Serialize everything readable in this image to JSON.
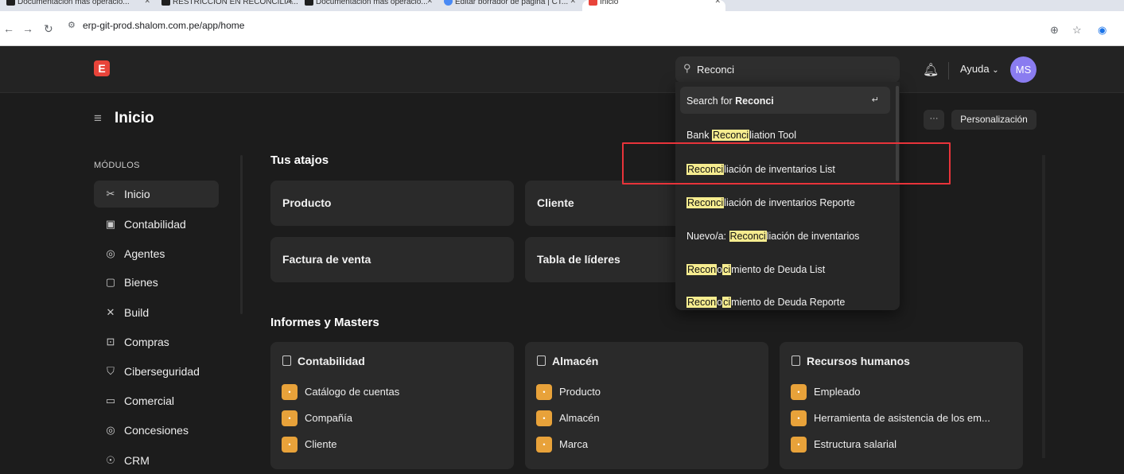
{
  "browser": {
    "tabs": [
      {
        "label": "Documentación más operació..."
      },
      {
        "label": "RESTRICCIÓN EN RECONCILIA..."
      },
      {
        "label": "Documentación más operació..."
      },
      {
        "label": "Editar borrador de página | CT..."
      },
      {
        "label": "Inicio"
      }
    ],
    "url": "erp-git-prod.shalom.com.pe/app/home"
  },
  "navbar": {
    "logo_letter": "E",
    "search_value": "Reconci",
    "help_label": "Ayuda",
    "avatar_initials": "MS"
  },
  "page": {
    "title": "Inicio",
    "more_label": "···",
    "customize_label": "Personalización"
  },
  "sidebar": {
    "section_label": "MÓDULOS",
    "items": [
      {
        "label": "Inicio",
        "icon": "tools-icon"
      },
      {
        "label": "Contabilidad",
        "icon": "accounting-icon"
      },
      {
        "label": "Agentes",
        "icon": "agents-icon"
      },
      {
        "label": "Bienes",
        "icon": "assets-icon"
      },
      {
        "label": "Build",
        "icon": "build-icon"
      },
      {
        "label": "Compras",
        "icon": "purchases-icon"
      },
      {
        "label": "Ciberseguridad",
        "icon": "shield-icon"
      },
      {
        "label": "Comercial",
        "icon": "folder-icon"
      },
      {
        "label": "Concesiones",
        "icon": "concessions-icon"
      },
      {
        "label": "CRM",
        "icon": "crm-icon"
      }
    ]
  },
  "shortcuts": {
    "title": "Tus atajos",
    "items": [
      "Producto",
      "Cliente",
      "Factura de venta",
      "Tabla de líderes"
    ]
  },
  "masters": {
    "title": "Informes y Masters",
    "cards": [
      {
        "title": "Contabilidad",
        "links": [
          "Catálogo de cuentas",
          "Compañía",
          "Cliente"
        ]
      },
      {
        "title": "Almacén",
        "links": [
          "Producto",
          "Almacén",
          "Marca"
        ]
      },
      {
        "title": "Recursos humanos",
        "links": [
          "Empleado",
          "Herramienta de asistencia de los em...",
          "Estructura salarial"
        ]
      }
    ]
  },
  "search_dropdown": {
    "search_for_prefix": "Search for ",
    "search_for_term": "Reconci",
    "enter_symbol": "↵",
    "results": [
      {
        "before": "Bank ",
        "match": "Reconci",
        "after": "liation Tool"
      },
      {
        "before": "",
        "match": "Reconci",
        "after": "liación de inventarios List"
      },
      {
        "before": "",
        "match": "Reconci",
        "after": "liación de inventarios Reporte"
      },
      {
        "before": "Nuevo/a: ",
        "match": "Reconci",
        "after": "liación de inventarios"
      },
      {
        "before": "",
        "match": "Recon",
        "mid": "o",
        "match2": "ci",
        "after": "miento de Deuda List"
      },
      {
        "before": "",
        "match": "Recon",
        "mid": "o",
        "match2": "ci",
        "after": "miento de Deuda Reporte"
      }
    ]
  },
  "colors": {
    "accent_logo": "#e8443a",
    "avatar": "#8a7cf0",
    "link_badge": "#e8a23a",
    "highlight_box": "#e8333a",
    "match_highlight": "#f6ec8f"
  }
}
